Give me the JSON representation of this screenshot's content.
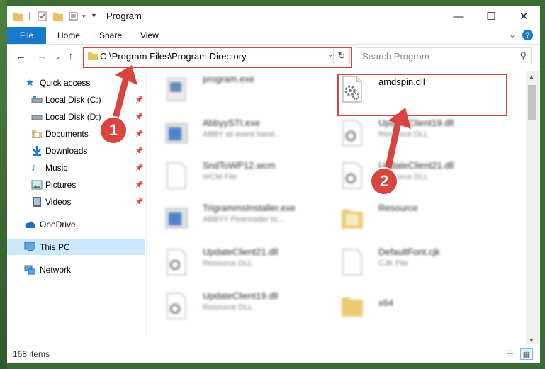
{
  "window": {
    "title": "Program"
  },
  "ribbon": {
    "file": "File",
    "tabs": [
      "Home",
      "Share",
      "View"
    ]
  },
  "nav": {
    "address": "C:\\Program Files\\Program Directory",
    "search_placeholder": "Search Program"
  },
  "sidebar": {
    "quick_access": "Quick access",
    "items": [
      {
        "label": "Local Disk (C:)",
        "icon": "drive-icon"
      },
      {
        "label": "Local Disk (D:)",
        "icon": "drive-icon"
      },
      {
        "label": "Documents",
        "icon": "documents-icon"
      },
      {
        "label": "Downloads",
        "icon": "downloads-icon"
      },
      {
        "label": "Music",
        "icon": "music-icon"
      },
      {
        "label": "Pictures",
        "icon": "pictures-icon"
      },
      {
        "label": "Videos",
        "icon": "videos-icon"
      }
    ],
    "onedrive": "OneDrive",
    "thispc": "This PC",
    "network": "Network"
  },
  "files": [
    {
      "name": "program.exe",
      "type": ""
    },
    {
      "name": "amdspin.dll",
      "type": ""
    },
    {
      "name": "AbbyySTI.exe",
      "type": "ABBY sti event hand..."
    },
    {
      "name": "UpdateClient19.dll",
      "type": "Resource DLL"
    },
    {
      "name": "SndToWP12.wcm",
      "type": "WCM File"
    },
    {
      "name": "UpdateClient21.dll",
      "type": "Resource DLL"
    },
    {
      "name": "TrigrammsInstaller.exe",
      "type": "ABBYY Finereader to..."
    },
    {
      "name": "Resource",
      "type": ""
    },
    {
      "name": "UpdateClient21.dll",
      "type": "Resource DLL"
    },
    {
      "name": "DefaultFont.cjk",
      "type": "CJK File"
    },
    {
      "name": "UpdateClient19.dll",
      "type": "Resource DLL"
    },
    {
      "name": "x64",
      "type": ""
    }
  ],
  "status": {
    "items": "168 items"
  },
  "callouts": {
    "one": "1",
    "two": "2"
  },
  "colors": {
    "accent": "#1979ca",
    "highlight": "#d9453e",
    "selection": "#cce8ff"
  }
}
